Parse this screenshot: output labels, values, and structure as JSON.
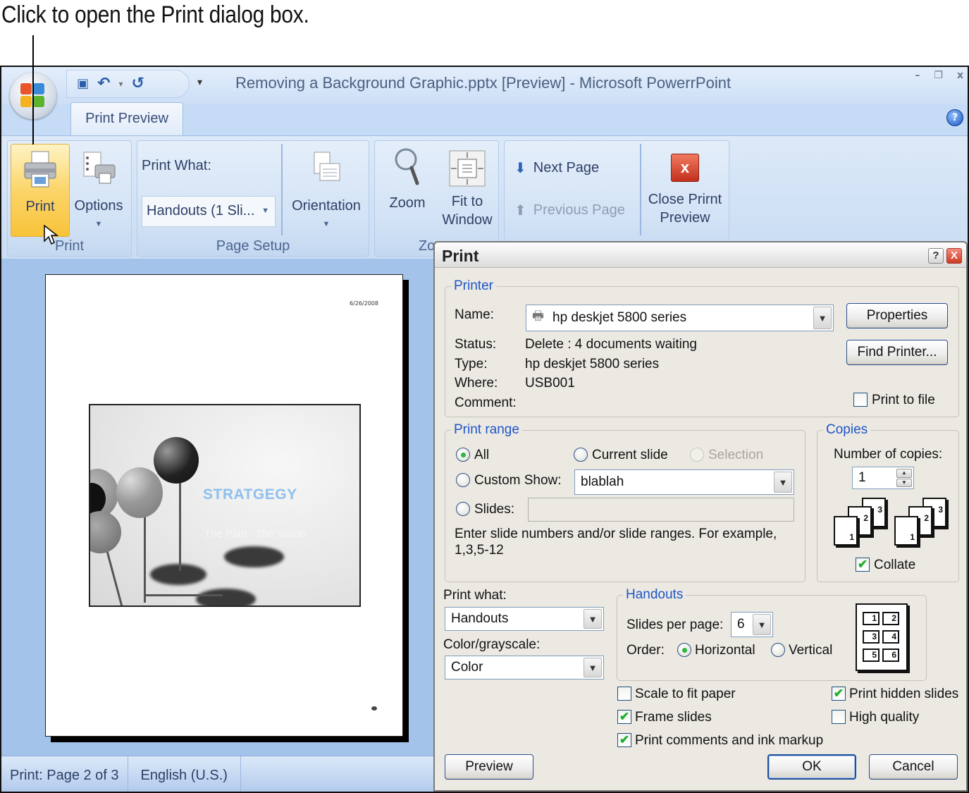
{
  "caption": "Click to open the Print dialog box.",
  "window": {
    "title": "Removing a Background Graphic.pptx [Preview] - Microsoft PowerrPoint",
    "controls": {
      "minimize": "–",
      "restore": "❐",
      "close": "x"
    }
  },
  "quick_access": {
    "save_icon": "💾",
    "undo_icon": "↶",
    "undo_dropdown": "▾",
    "redo_icon": "↺",
    "customize_dropdown": "▾"
  },
  "ribbon": {
    "active_tab": "Print Preview",
    "groups": {
      "print": {
        "label": "Print",
        "print_button": "Print",
        "options_button": "Options"
      },
      "page_setup": {
        "label": "Page Setup",
        "print_what_label": "Print What:",
        "print_what_value": "Handouts (1 Sli...",
        "orientation_button": "Orientation"
      },
      "zoom": {
        "label": "Zoom",
        "zoom_button": "Zoom",
        "fit_button_line1": "Fit to",
        "fit_button_line2": "Window"
      },
      "preview": {
        "next_page": "Next Page",
        "previous_page": "Previous Page",
        "close_line1": "Close Prirnt",
        "close_line2": "Preview"
      }
    }
  },
  "preview_page": {
    "date": "6/26/2008",
    "slide_title": "STRATGEGY",
    "slide_subtitle": "The Plan -  The Vision"
  },
  "statusbar": {
    "page": "Print: Page 2 of 3",
    "language": "English (U.S.)"
  },
  "print_dialog": {
    "title": "Print",
    "help_button": "?",
    "close_button": "X",
    "printer": {
      "legend": "Printer",
      "name_label": "Name:",
      "name_value": "hp deskjet 5800 series",
      "status_label": "Status:",
      "status_value": "Delete : 4 documents waiting",
      "type_label": "Type:",
      "type_value": "hp deskjet 5800 series",
      "where_label": "Where:",
      "where_value": "USB001",
      "comment_label": "Comment:",
      "comment_value": "",
      "properties_button": "Properties",
      "find_printer_button": "Find Printer...",
      "print_to_file_label": "Print to file",
      "print_to_file_checked": false
    },
    "print_range": {
      "legend": "Print range",
      "all_label": "All",
      "current_slide_label": "Current slide",
      "selection_label": "Selection",
      "custom_show_label": "Custom Show:",
      "custom_show_value": "blablah",
      "slides_label": "Slides:",
      "slides_value": "",
      "hint": "Enter slide numbers and/or slide ranges. For example,",
      "hint_example": "1,3,5-12",
      "selected": "All"
    },
    "copies": {
      "legend": "Copies",
      "number_label": "Number of copies:",
      "number_value": "1",
      "collate_label": "Collate",
      "collate_checked": true,
      "page_labels": [
        "1",
        "2",
        "3"
      ]
    },
    "print_what": {
      "label": "Print what:",
      "value": "Handouts"
    },
    "color": {
      "label": "Color/grayscale:",
      "value": "Color"
    },
    "handouts": {
      "legend": "Handouts",
      "slides_per_page_label": "Slides per page:",
      "slides_per_page_value": "6",
      "order_label": "Order:",
      "horizontal_label": "Horizontal",
      "vertical_label": "Vertical",
      "order_selected": "Horizontal",
      "layout_numbers": [
        "1",
        "2",
        "3",
        "4",
        "5",
        "6"
      ]
    },
    "options": {
      "scale_to_fit": {
        "label": "Scale to fit paper",
        "checked": false
      },
      "frame_slides": {
        "label": "Frame slides",
        "checked": true
      },
      "print_comments": {
        "label": "Print comments and ink markup",
        "checked": true
      },
      "print_hidden": {
        "label": "Print hidden slides",
        "checked": true
      },
      "high_quality": {
        "label": "High quality",
        "checked": false
      }
    },
    "buttons": {
      "preview": "Preview",
      "ok": "OK",
      "cancel": "Cancel"
    },
    "check_glyph": "✔"
  }
}
